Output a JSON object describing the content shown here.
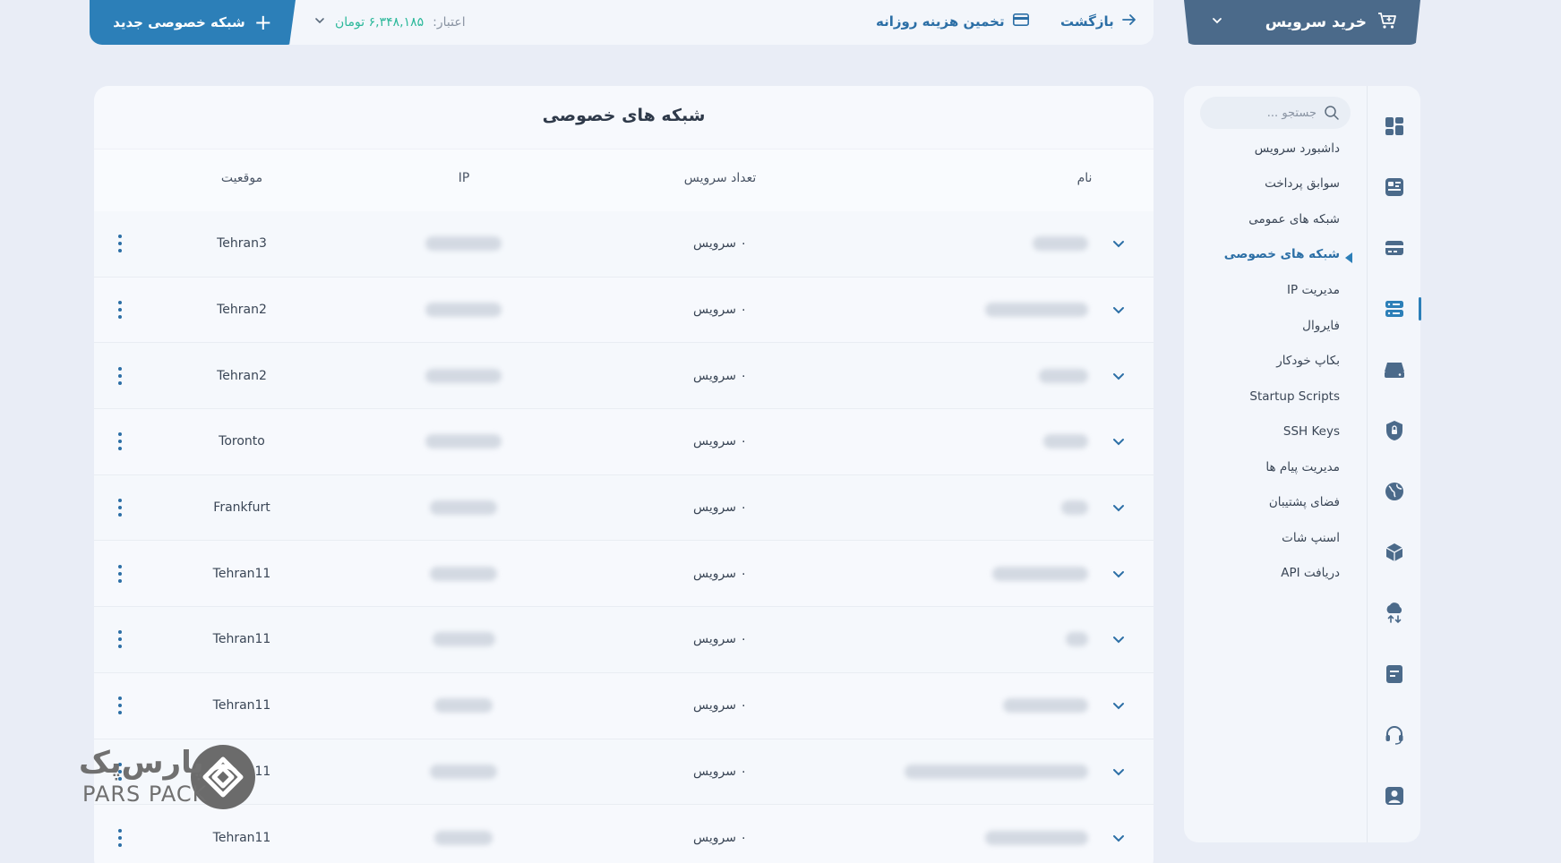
{
  "topbar": {
    "new_network_label": "شبکه خصوصی جدید",
    "credit_label": "اعتبار:",
    "credit_value": "۶,۳۴۸,۱۸۵ تومان",
    "estimate_label": "تخمین هزینه روزانه",
    "back_label": "بازگشت",
    "buy_label": "خرید سرویس"
  },
  "page": {
    "title": "شبکه های خصوصی"
  },
  "table": {
    "headers": {
      "name": "نام",
      "count": "تعداد سرویس",
      "ip": "IP",
      "location": "موقعیت"
    },
    "rows": [
      {
        "count": "۰ سرویس",
        "location": "Tehran3"
      },
      {
        "count": "۰ سرویس",
        "location": "Tehran2"
      },
      {
        "count": "۰ سرویس",
        "location": "Tehran2"
      },
      {
        "count": "۰ سرویس",
        "location": "Toronto"
      },
      {
        "count": "۰ سرویس",
        "location": "Frankfurt"
      },
      {
        "count": "۰ سرویس",
        "location": "Tehran11"
      },
      {
        "count": "۰ سرویس",
        "location": "Tehran11"
      },
      {
        "count": "۰ سرویس",
        "location": "Tehran11"
      },
      {
        "count": "۰ سرویس",
        "location": "Tehran11"
      },
      {
        "count": "۰ سرویس",
        "location": "Tehran11"
      }
    ]
  },
  "sidebar": {
    "search_placeholder": "جستجو ...",
    "items": [
      {
        "label": "داشبورد سرویس"
      },
      {
        "label": "سوابق پرداخت"
      },
      {
        "label": "شبکه های عمومی"
      },
      {
        "label": "شبکه های خصوصی",
        "active": true
      },
      {
        "label": "مدیریت IP"
      },
      {
        "label": "فایروال"
      },
      {
        "label": "بکاپ خودکار"
      },
      {
        "label": "Startup Scripts"
      },
      {
        "label": "SSH Keys"
      },
      {
        "label": "مدیریت پیام ها"
      },
      {
        "label": "فضای پشتیبان"
      },
      {
        "label": "اسنپ شات"
      },
      {
        "label": "دریافت API"
      }
    ],
    "rail_icons": [
      "dashboard-icon",
      "payments-icon",
      "public-network-icon",
      "private-network-icon",
      "server-icon",
      "lock-icon",
      "globe-icon",
      "cube-icon",
      "cloud-transfer-icon",
      "document-icon",
      "headset-icon",
      "user-icon"
    ]
  },
  "watermark": {
    "fa": "پارس‌پک",
    "en": "PARS PACK"
  },
  "colors": {
    "primary": "#2c7fb8",
    "buy": "#4b6a8a",
    "credit": "#2bb89a",
    "background": "#e9edf6"
  }
}
